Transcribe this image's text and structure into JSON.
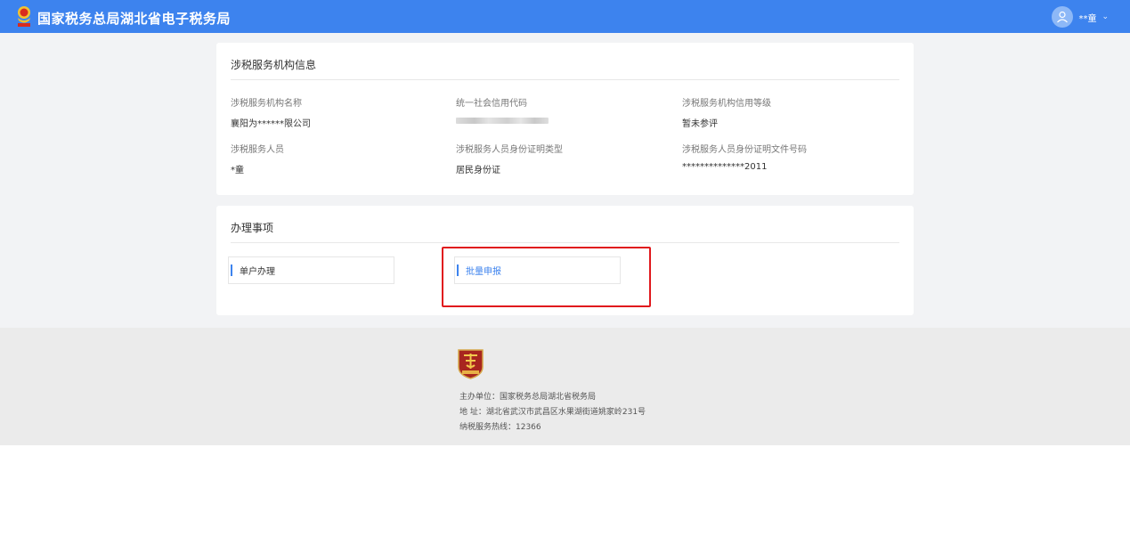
{
  "header": {
    "title": "国家税务总局湖北省电子税务局",
    "user_name": "**童",
    "logo_icon": "tax-emblem-icon",
    "colors": {
      "bar": "#3d83ee"
    }
  },
  "agency_info": {
    "title": "涉税服务机构信息",
    "fields": [
      {
        "label": "涉税服务机构名称",
        "value": "襄阳为******限公司"
      },
      {
        "label": "统一社会信用代码",
        "value": ""
      },
      {
        "label": "涉税服务机构信用等级",
        "value": "暂未参评"
      },
      {
        "label": "涉税服务人员",
        "value": "*童"
      },
      {
        "label": "涉税服务人员身份证明类型",
        "value": "居民身份证"
      },
      {
        "label": "涉税服务人员身份证明文件号码",
        "value": "**************2011"
      }
    ]
  },
  "tasks": {
    "title": "办理事项",
    "items": [
      {
        "label": "单户办理"
      },
      {
        "label": "批量申报"
      }
    ]
  },
  "footer": {
    "logo_icon": "tax-shield-logo-icon",
    "sponsor": "主办单位：国家税务总局湖北省税务局",
    "address": "地 址：湖北省武汉市武昌区水果湖街道姚家岭231号",
    "hotline": "纳税服务热线：12366"
  }
}
